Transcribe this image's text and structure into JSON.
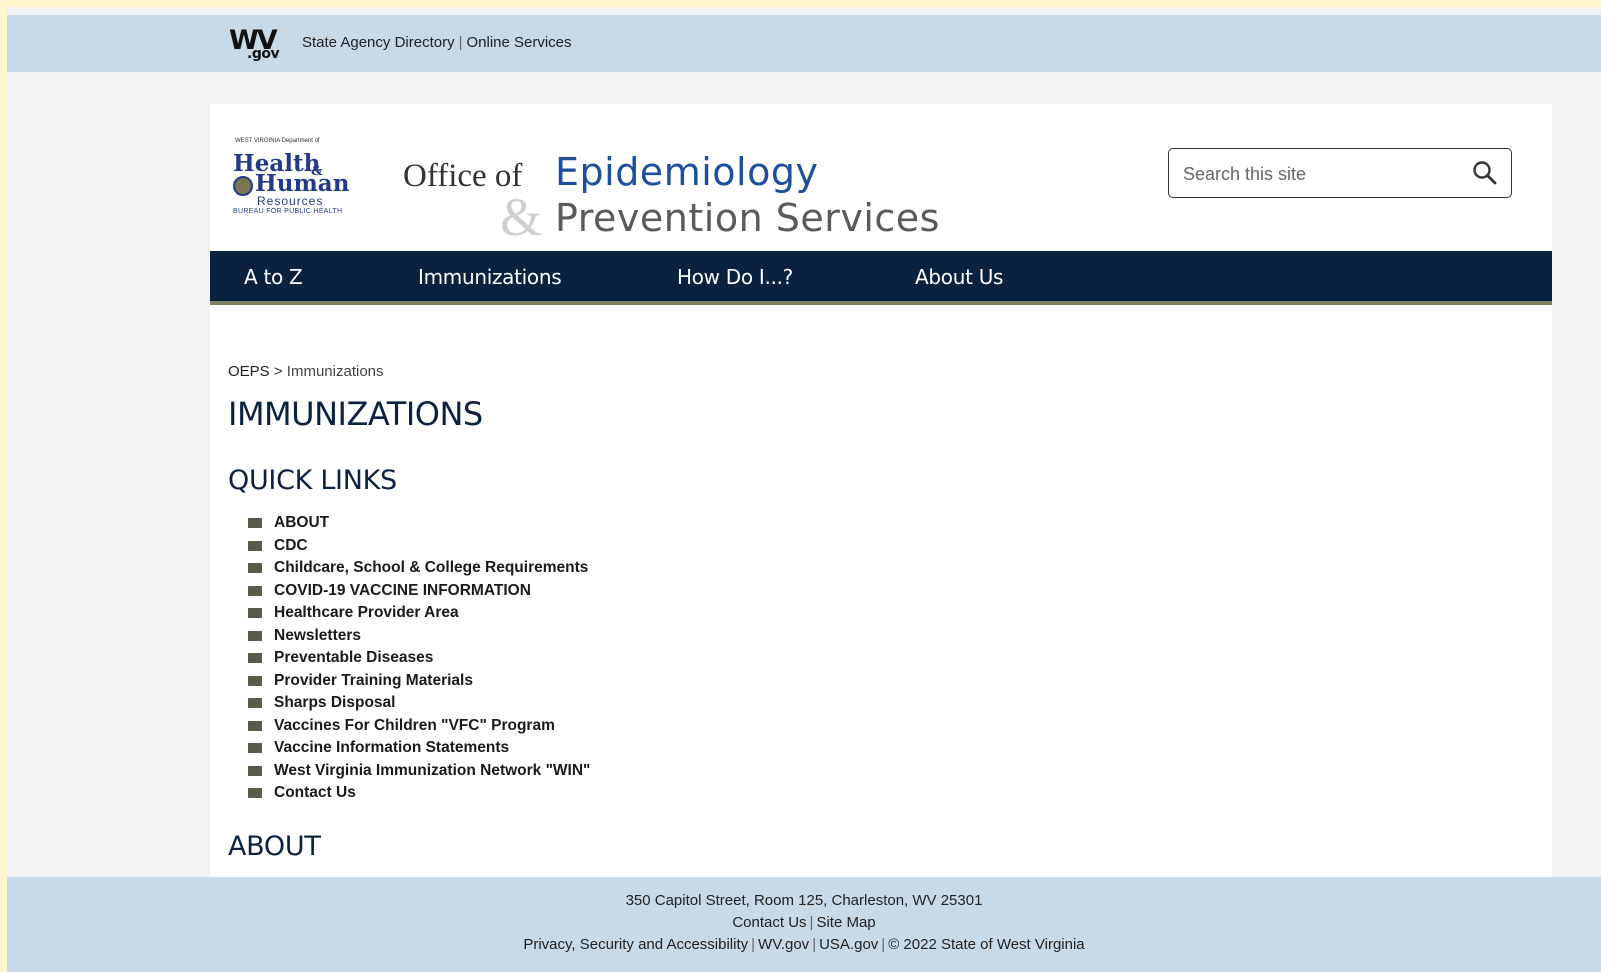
{
  "topbar": {
    "logo_main": "WV",
    "logo_sub": ".gov",
    "agency_directory": "State Agency Directory",
    "online_services": "Online Services"
  },
  "header": {
    "dhhr_logo": {
      "tiny": "WEST VIRGINIA Department of",
      "health": "Health",
      "amp": "&",
      "human": "Human",
      "resources": "Resources",
      "bureau": "BUREAU FOR PUBLIC HEALTH"
    },
    "title_office": "Office of",
    "title_epidemiology": "Epidemiology",
    "title_amp": "&",
    "title_prevention": "Prevention Services",
    "search_placeholder": "Search this site"
  },
  "nav": [
    {
      "label": "A to Z"
    },
    {
      "label": "Immunizations"
    },
    {
      "label": "How Do I...?"
    },
    {
      "label": "About Us"
    }
  ],
  "breadcrumb": {
    "home": "OEPS",
    "separator": ">",
    "current": "Immunizations"
  },
  "page_title": "IMMUNIZATIONS",
  "quick_links_heading": "QUICK LINKS",
  "quick_links": [
    "ABOUT",
    "CDC",
    "Childcare, School & College Requirements",
    "COVID-19 VACCINE INFORMATION",
    "Healthcare Provider Area",
    "Newsletters",
    "Preventable Diseases",
    "Provider Training Materials",
    "Sharps Disposal",
    "Vaccines For Children \"VFC\" Program",
    "Vaccine Information Statements",
    "West Virginia Immunization Network \"WIN\"",
    "Contact Us"
  ],
  "about_heading": "ABOUT",
  "footer": {
    "address": "350 Capitol Street, Room 125, Charleston, WV 25301",
    "contact": "Contact Us",
    "sitemap": "Site Map",
    "privacy": "Privacy, Security and Accessibility",
    "wvgov": "WV.gov",
    "usagov": "USA.gov",
    "copyright": "© 2022 State of West Virginia"
  },
  "colors": {
    "nav_bg": "#0a2240",
    "topbar_bg": "#c8d9e8",
    "title_blue": "#1e4f9c",
    "bullet": "#5a5a4a"
  }
}
